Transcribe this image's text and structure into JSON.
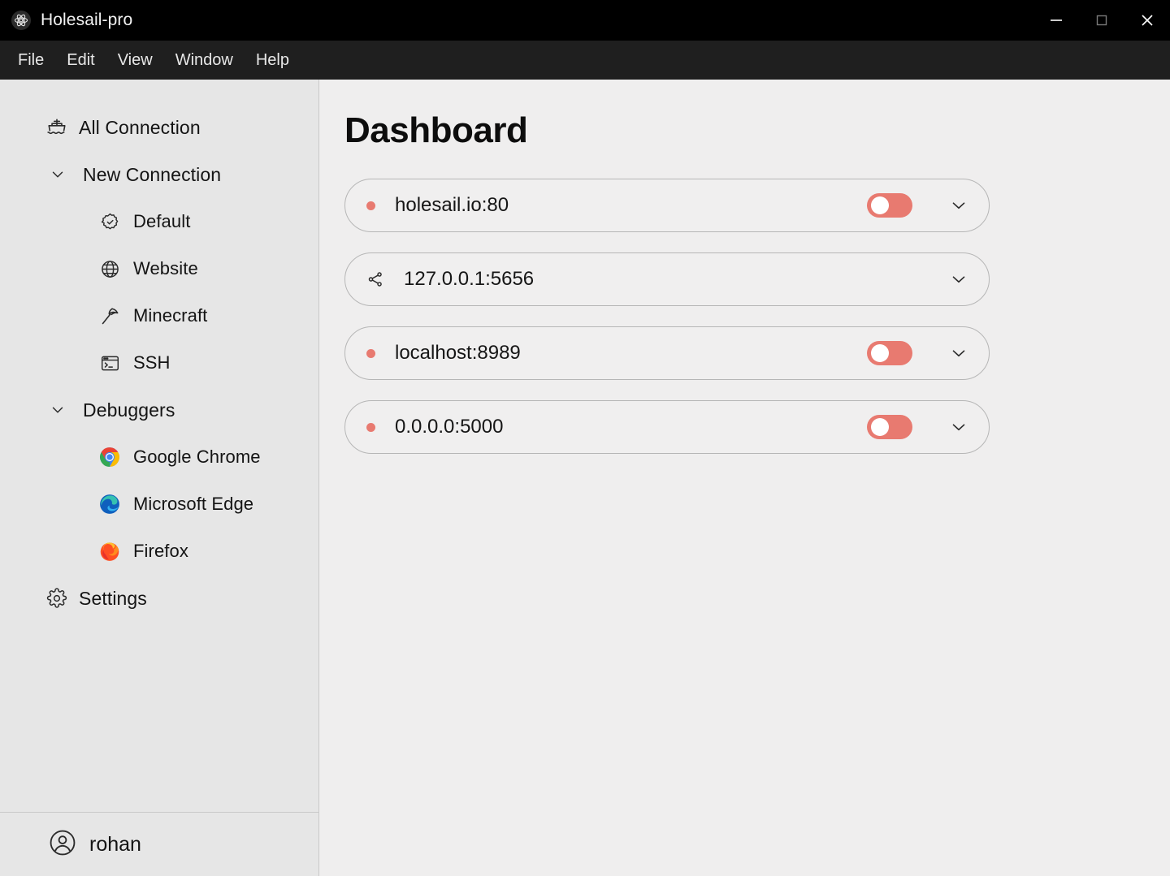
{
  "window": {
    "title": "Holesail-pro",
    "app_icon": "electron-atom-icon",
    "controls": {
      "minimize": "minimize-icon",
      "maximize": "maximize-icon",
      "close": "close-icon"
    }
  },
  "menubar": {
    "items": [
      {
        "label": "File"
      },
      {
        "label": "Edit"
      },
      {
        "label": "View"
      },
      {
        "label": "Window"
      },
      {
        "label": "Help"
      }
    ]
  },
  "sidebar": {
    "items": [
      {
        "label": "All Connection",
        "icon": "ship-icon",
        "level": "root"
      },
      {
        "label": "New Connection",
        "icon": "chevron-down-icon",
        "level": "group"
      },
      {
        "label": "Default",
        "icon": "badge-check-icon",
        "level": "child"
      },
      {
        "label": "Website",
        "icon": "globe-icon",
        "level": "child"
      },
      {
        "label": "Minecraft",
        "icon": "pickaxe-icon",
        "level": "child"
      },
      {
        "label": "SSH",
        "icon": "terminal-window-icon",
        "level": "child"
      },
      {
        "label": "Debuggers",
        "icon": "chevron-down-icon",
        "level": "group"
      },
      {
        "label": "Google Chrome",
        "icon": "chrome-logo-icon",
        "level": "child"
      },
      {
        "label": "Microsoft Edge",
        "icon": "edge-logo-icon",
        "level": "child"
      },
      {
        "label": "Firefox",
        "icon": "firefox-logo-icon",
        "level": "child"
      },
      {
        "label": "Settings",
        "icon": "gear-icon",
        "level": "root"
      }
    ],
    "footer": {
      "user": "rohan",
      "avatar_icon": "user-circle-icon"
    }
  },
  "main": {
    "title": "Dashboard",
    "connections": [
      {
        "name": "holesail.io:80",
        "lead_icon": "status-dot",
        "status": "offline",
        "has_toggle": true,
        "toggle_on": false,
        "expand_icon": "chevron-down-icon"
      },
      {
        "name": "127.0.0.1:5656",
        "lead_icon": "share-icon",
        "status": "shared",
        "has_toggle": false,
        "toggle_on": false,
        "expand_icon": "chevron-down-icon"
      },
      {
        "name": "localhost:8989",
        "lead_icon": "status-dot",
        "status": "offline",
        "has_toggle": true,
        "toggle_on": false,
        "expand_icon": "chevron-down-icon"
      },
      {
        "name": "0.0.0.0:5000",
        "lead_icon": "status-dot",
        "status": "offline",
        "has_toggle": true,
        "toggle_on": false,
        "expand_icon": "chevron-down-icon"
      }
    ]
  },
  "colors": {
    "titlebar_bg": "#000000",
    "menubar_bg": "#1f1f1f",
    "sidebar_bg": "#e6e6e6",
    "content_bg": "#efeeee",
    "accent_red": "#e87a70",
    "card_border": "#b6b6b6",
    "text_primary": "#141414"
  }
}
